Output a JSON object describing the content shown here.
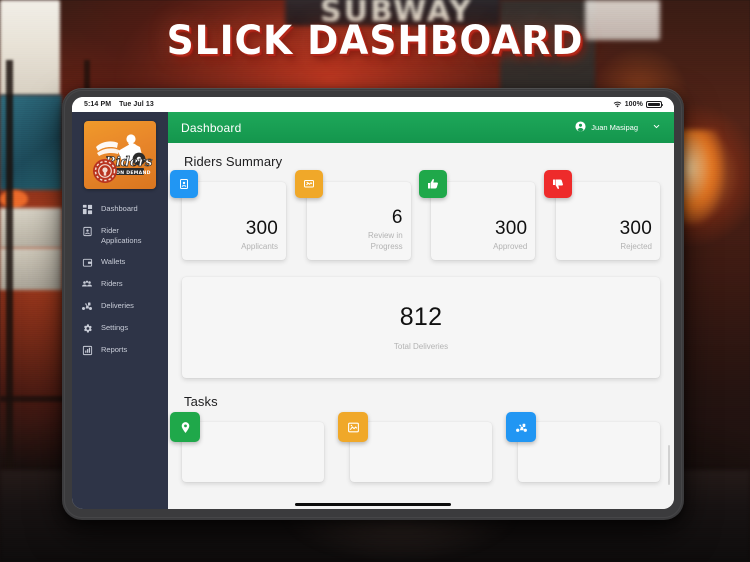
{
  "hero": {
    "title": "SLICK DASHBOARD"
  },
  "status_bar": {
    "time": "5:14 PM",
    "date": "Tue Jul 13",
    "battery_percent": "100%",
    "wifi_icon": "wifi-icon",
    "battery_icon": "battery-full-icon"
  },
  "sidebar": {
    "logo": {
      "brand": "Riders",
      "tagline": "ON DEMAND",
      "bg_color": "#e8862a"
    },
    "bg_color": "#2e3447",
    "items": [
      {
        "label": "Dashboard",
        "icon": "dashboard-grid-icon"
      },
      {
        "label": "Rider Applications",
        "icon": "id-badge-icon"
      },
      {
        "label": "Wallets",
        "icon": "wallet-icon"
      },
      {
        "label": "Riders",
        "icon": "people-group-icon"
      },
      {
        "label": "Deliveries",
        "icon": "scooter-delivery-icon"
      },
      {
        "label": "Settings",
        "icon": "gear-icon"
      },
      {
        "label": "Reports",
        "icon": "bar-chart-icon"
      }
    ]
  },
  "appbar": {
    "title": "Dashboard",
    "bg_color": "#179c52",
    "user": {
      "name": "Juan Masipag",
      "avatar_icon": "account-circle-icon",
      "chevron_icon": "chevron-down-icon"
    }
  },
  "main": {
    "riders_summary": {
      "heading": "Riders Summary",
      "cards": [
        {
          "value": "300",
          "label": "Applicants",
          "icon": "id-card-icon",
          "color": "#2196f3"
        },
        {
          "value": "6",
          "label": "Review in Progress",
          "icon": "review-document-icon",
          "color": "#f0a829"
        },
        {
          "value": "300",
          "label": "Approved",
          "icon": "thumbs-up-icon",
          "color": "#1fa84a"
        },
        {
          "value": "300",
          "label": "Rejected",
          "icon": "thumbs-down-icon",
          "color": "#ee2b2b"
        }
      ]
    },
    "total_deliveries": {
      "value": "812",
      "label": "Total Deliveries"
    },
    "tasks": {
      "heading": "Tasks",
      "cards": [
        {
          "icon": "location-pin-icon",
          "color": "#1fa84a"
        },
        {
          "icon": "photo-upload-icon",
          "color": "#f0a829"
        },
        {
          "icon": "scooter-delivery-icon",
          "color": "#2196f3"
        }
      ]
    }
  }
}
